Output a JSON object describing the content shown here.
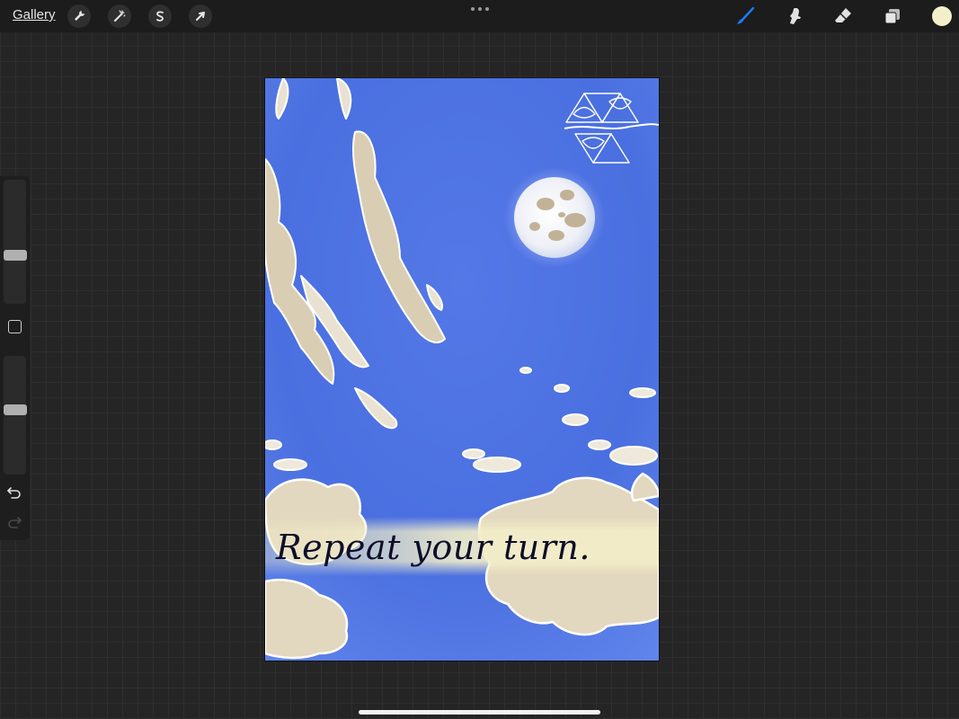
{
  "topbar": {
    "gallery_label": "Gallery",
    "left_tools": [
      "wrench-icon",
      "magic-wand-icon",
      "selection-s-icon",
      "transform-arrow-icon"
    ],
    "right_tools": [
      "brush-icon",
      "smudge-icon",
      "eraser-icon",
      "layers-icon"
    ],
    "active_tool": "brush-icon",
    "accent_color": "#1a7cf5",
    "current_color": "#f3efc8"
  },
  "sidebar": {
    "brush_size": 0.38,
    "brush_opacity": 0.55,
    "controls": [
      "modify-square-icon",
      "undo-icon",
      "redo-icon"
    ]
  },
  "canvas": {
    "caption": "Repeat your turn.",
    "sky_color": "#4a6fe0",
    "emblem": "celtic-triangle-knot-emblem",
    "moon": "full-moon"
  }
}
